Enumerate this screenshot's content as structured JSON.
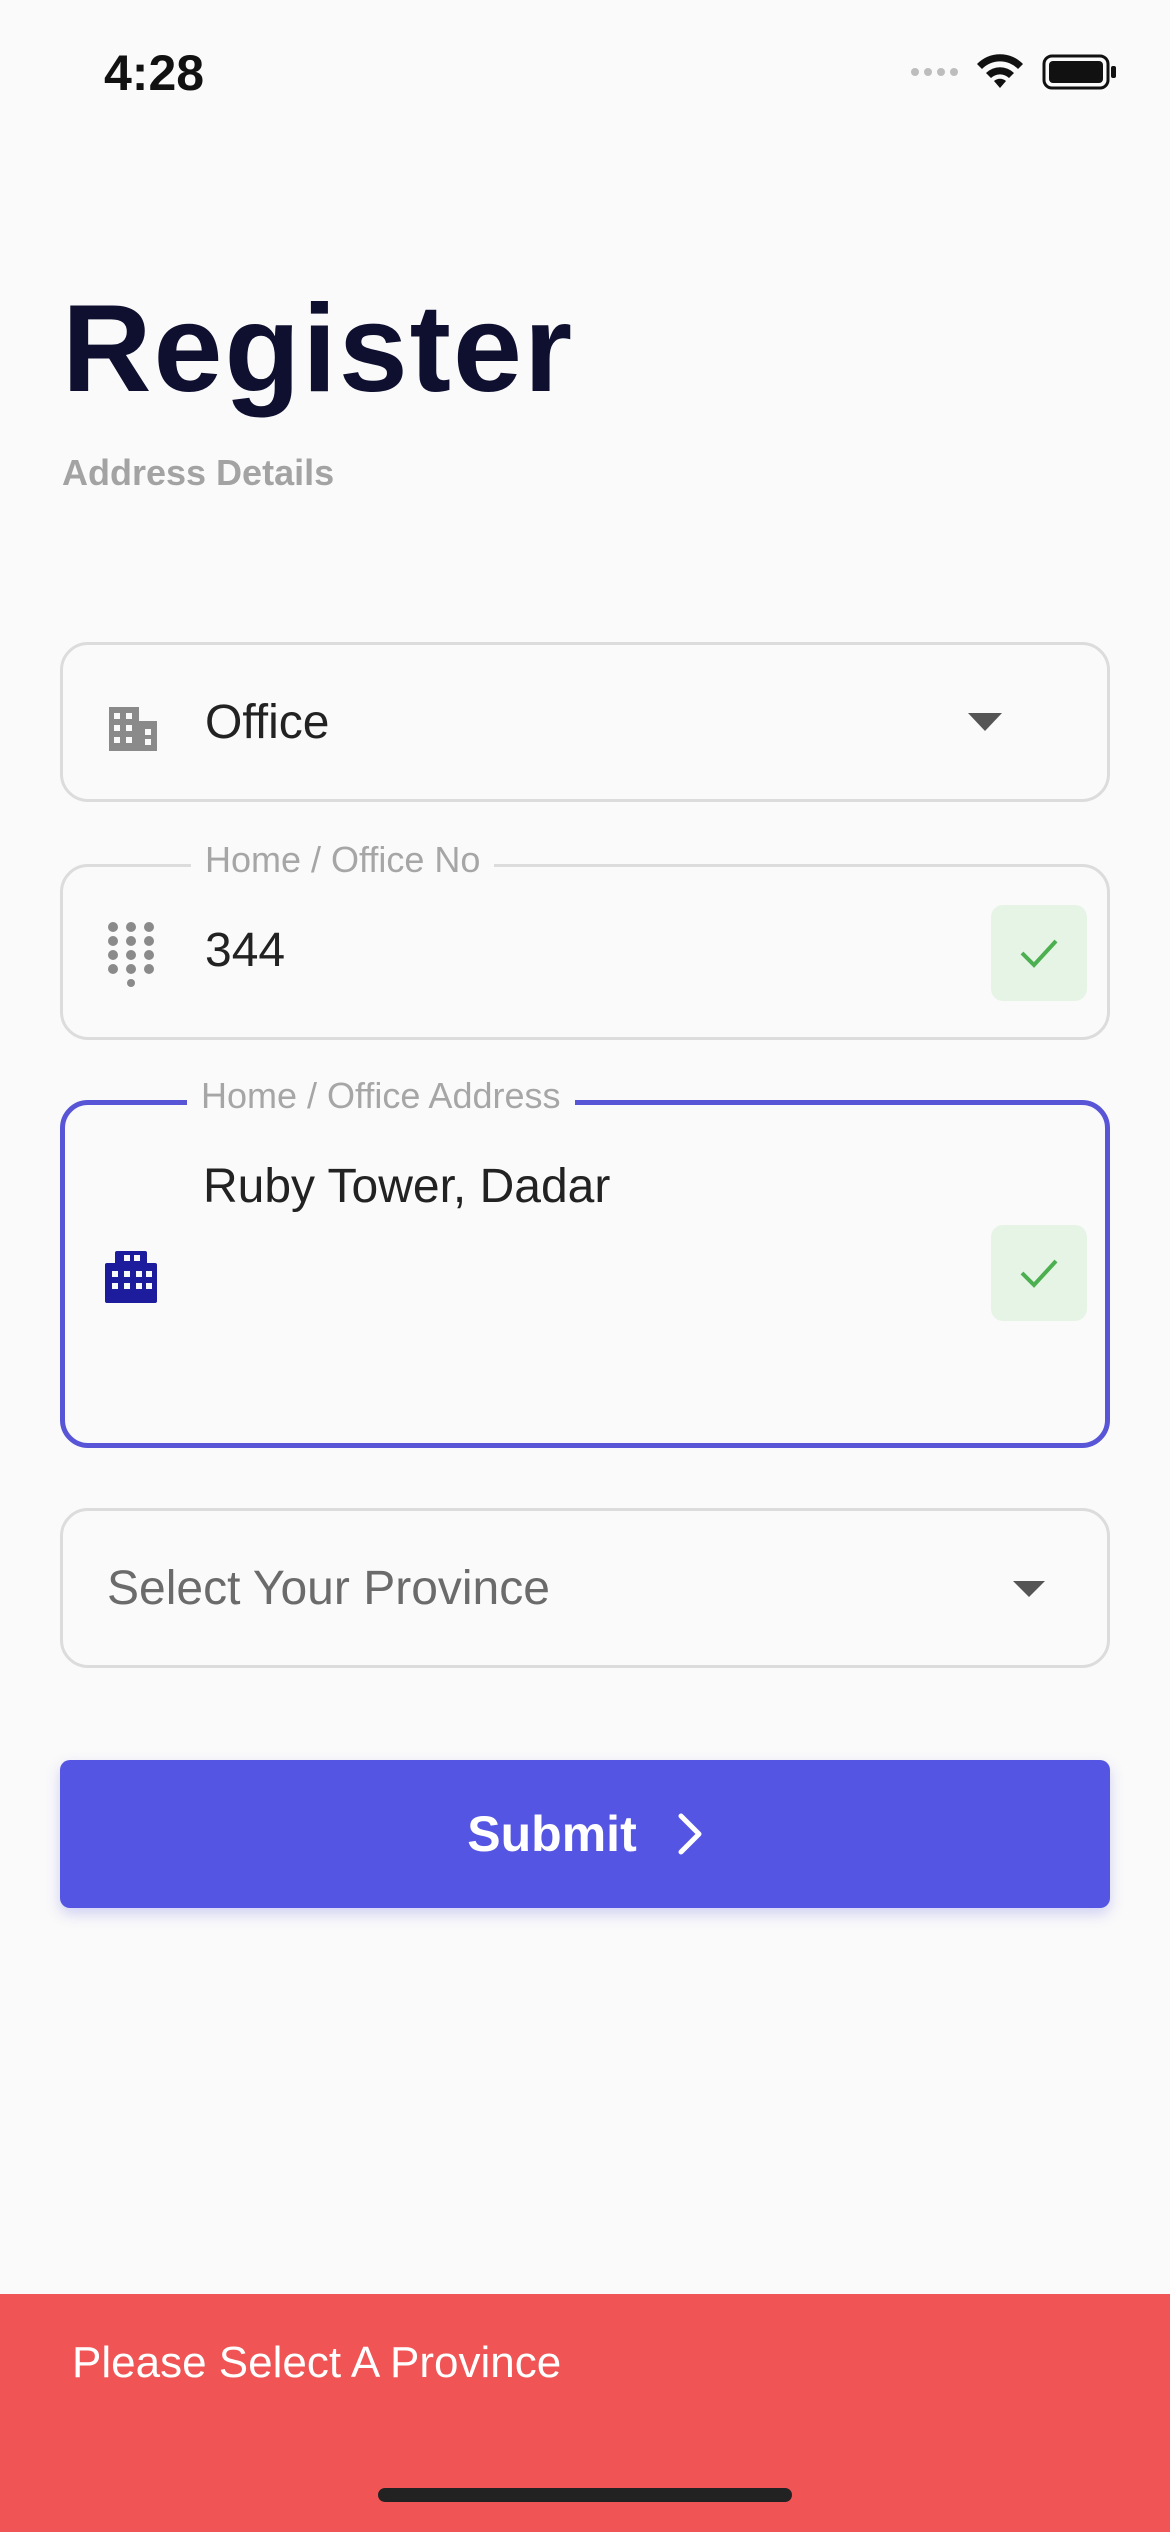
{
  "status_bar": {
    "time": "4:28"
  },
  "header": {
    "title": "Register",
    "subtitle": "Address Details"
  },
  "form": {
    "address_type": {
      "value": "Office",
      "icon": "building-icon"
    },
    "home_office_no": {
      "label": "Home / Office No",
      "value": "344",
      "valid": true
    },
    "home_office_address": {
      "label": "Home / Office Address",
      "value": "Ruby Tower, Dadar",
      "valid": true,
      "focused": true
    },
    "province": {
      "placeholder": "Select Your Province"
    }
  },
  "submit": {
    "label": "Submit"
  },
  "toast": {
    "message": "Please Select A Province"
  },
  "colors": {
    "accent": "#5555e3",
    "focus_border": "#5856d6",
    "success": "#4caf50",
    "error": "#f05454",
    "title": "#0f1030"
  }
}
